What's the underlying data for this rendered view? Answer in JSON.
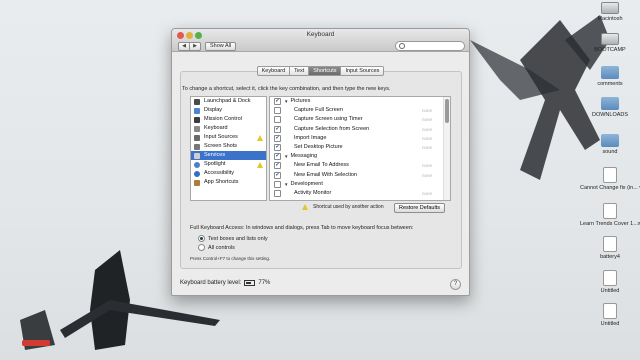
{
  "window": {
    "title": "Keyboard",
    "show_all": "Show All",
    "search_placeholder": ""
  },
  "tabs": [
    {
      "label": "Keyboard",
      "active": false
    },
    {
      "label": "Text",
      "active": false
    },
    {
      "label": "Shortcuts",
      "active": true
    },
    {
      "label": "Input Sources",
      "active": false
    }
  ],
  "instructions": "To change a shortcut, select it, click the key combination, and then type the new keys.",
  "categories": [
    {
      "label": "Launchpad & Dock",
      "icon": "launchpad-icon",
      "color": "#4a4a4a"
    },
    {
      "label": "Display",
      "icon": "display-icon",
      "color": "#4b86d6"
    },
    {
      "label": "Mission Control",
      "icon": "mission-control-icon",
      "color": "#3b3b3b"
    },
    {
      "label": "Keyboard",
      "icon": "keyboard-icon",
      "color": "#8a8a8a"
    },
    {
      "label": "Input Sources",
      "icon": "input-sources-icon",
      "color": "#6a6a6a",
      "warning": true
    },
    {
      "label": "Screen Shots",
      "icon": "screenshot-icon",
      "color": "#777777"
    },
    {
      "label": "Services",
      "icon": "services-icon",
      "color": "#7a7a7a",
      "selected": true
    },
    {
      "label": "Spotlight",
      "icon": "spotlight-icon",
      "color": "#4a7fd0",
      "warning": true
    },
    {
      "label": "Accessibility",
      "icon": "accessibility-icon",
      "color": "#2f6fc4"
    },
    {
      "label": "App Shortcuts",
      "icon": "app-shortcuts-icon",
      "color": "#b07a3a"
    }
  ],
  "shortcuts": [
    {
      "label": "Pictures",
      "group": true,
      "checked": true
    },
    {
      "label": "Capture Full Screen",
      "checked": false
    },
    {
      "label": "Capture Screen using Timer",
      "checked": false
    },
    {
      "label": "Capture Selection from Screen",
      "checked": true
    },
    {
      "label": "Import Image",
      "checked": true
    },
    {
      "label": "Set Desktop Picture",
      "checked": true
    },
    {
      "label": "Messaging",
      "group": true,
      "checked": true
    },
    {
      "label": "New Email To Address",
      "checked": true
    },
    {
      "label": "New Email With Selection",
      "checked": true
    },
    {
      "label": "Development",
      "group": true,
      "checked": false
    },
    {
      "label": "Activity Monitor",
      "checked": false
    }
  ],
  "note": "Shortcut used by another action",
  "restore_defaults": "Restore Defaults",
  "full_keyboard_access": "Full Keyboard Access: In windows and dialogs, press Tab to move keyboard focus between:",
  "radio_options": [
    {
      "label": "Text boxes and lists only",
      "selected": true
    },
    {
      "label": "All controls",
      "selected": false
    }
  ],
  "control_hint": "Press Control+F7 to change this setting.",
  "battery": {
    "label": "Keyboard battery level:",
    "value": "77%"
  },
  "help": "?",
  "desktop_icons": [
    {
      "label": "Macintosh",
      "type": "drive"
    },
    {
      "label": "BOOTCAMP",
      "type": "drive"
    },
    {
      "label": "comments",
      "type": "folder"
    },
    {
      "label": "DOWNLOADS",
      "type": "folder"
    },
    {
      "label": "sound",
      "type": "folder"
    },
    {
      "label": "Cannot Change fix (in... vdm.mp4",
      "type": "file"
    },
    {
      "label": "Learn Trends Cover 1...wmv.mp4",
      "type": "file"
    },
    {
      "label": "battery4",
      "type": "file"
    },
    {
      "label": "Untitled",
      "type": "file"
    },
    {
      "label": "Untitled",
      "type": "file"
    }
  ]
}
